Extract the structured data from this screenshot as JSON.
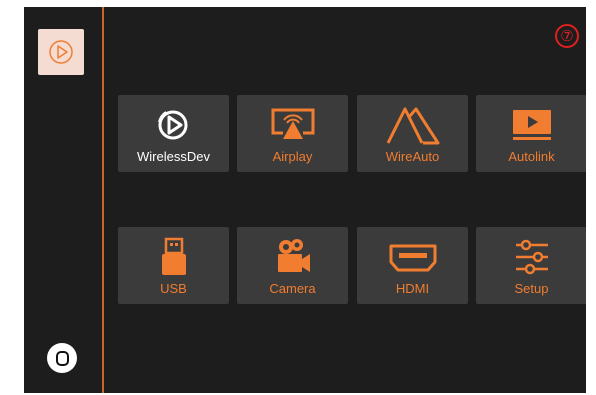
{
  "status": {
    "page_badge": "⑦"
  },
  "sidebar": {
    "app_icon": "play-icon",
    "home_icon": "home-button-icon"
  },
  "tiles": [
    {
      "label": "WirelessDev",
      "icon": "wireless-play-icon"
    },
    {
      "label": "Airplay",
      "icon": "airplay-icon"
    },
    {
      "label": "WireAuto",
      "icon": "android-auto-icon"
    },
    {
      "label": "Autolink",
      "icon": "autolink-monitor-icon"
    },
    {
      "label": "USB",
      "icon": "usb-icon"
    },
    {
      "label": "Camera",
      "icon": "camera-icon"
    },
    {
      "label": "HDMI",
      "icon": "hdmi-icon"
    },
    {
      "label": "Setup",
      "icon": "settings-sliders-icon"
    }
  ],
  "colors": {
    "accent": "#f07d30",
    "tile_bg": "#3b3b3b",
    "screen_bg": "#1d1d1d",
    "badge": "#e02020"
  }
}
